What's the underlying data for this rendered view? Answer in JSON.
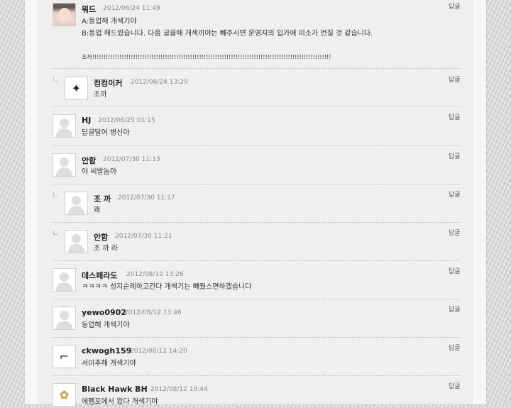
{
  "comments": [
    {
      "nick": "뭐드",
      "date": "2012/06/24 11:49",
      "lines": [
        "A:등업해 개색기야",
        "B:등업 해드렸습니다. 다음 글쓸때 개색끼야는 빼주시면 운영자의 입가에 미소가 번질 것 같습니다.",
        "",
        "조까!!!!!!!!!!!!!!!!!!!!!!!!!!!!!!!!!!!!!!!!!!!!!!!!!!!!!!!!!!!!!!!!!!!!!!!!!!!!!!!!!!!!!!!!!!!!!!!!!!!!!!!!!"
      ],
      "reply": "답글",
      "avatar": "photo"
    },
    {
      "nick": "컹컹이커",
      "date": "2012/06/24 13:29",
      "lines": [
        "조까"
      ],
      "reply": "답글",
      "avatar": "butterfly-icon",
      "nested": true
    },
    {
      "nick": "HJ",
      "date": "2012/06/25 01:15",
      "lines": [
        "답글달어 병신아"
      ],
      "reply": "답글",
      "avatar": "default"
    },
    {
      "nick": "안함",
      "date": "2012/07/30 11:13",
      "lines": [
        "야 씨발놈아"
      ],
      "reply": "답글",
      "avatar": "default"
    },
    {
      "nick": "조 까",
      "date": "2012/07/30 11:17",
      "lines": [
        "왜"
      ],
      "reply": "답글",
      "avatar": "default",
      "nested": true
    },
    {
      "nick": "안함",
      "date": "2012/07/30 11:21",
      "lines": [
        "조 까 라"
      ],
      "reply": "답글",
      "avatar": "default",
      "nested": true
    },
    {
      "nick": "데스페라도",
      "date": "2012/08/12 13:26",
      "lines": [
        "ㅋㅋㅋㅋ 성지순례하고간다 개색기는 빼줬스면하겠습니다"
      ],
      "reply": "답글",
      "avatar": "default"
    },
    {
      "nick": "yewo0902",
      "date": "2012/08/12 13:46",
      "lines": [
        "등업해 개색기야"
      ],
      "reply": "답글",
      "avatar": "default"
    },
    {
      "nick": "ckwogh159",
      "date": "2012/08/12 14:20",
      "lines": [
        "서미추해 개색기야"
      ],
      "reply": "답글",
      "avatar": "gun-icon"
    },
    {
      "nick": "Black Hawk BH",
      "date": "2012/08/12 19:44",
      "lines": [
        "에펨포에서 왔다 개색기야"
      ],
      "reply": "답글",
      "avatar": "flower-icon"
    }
  ]
}
